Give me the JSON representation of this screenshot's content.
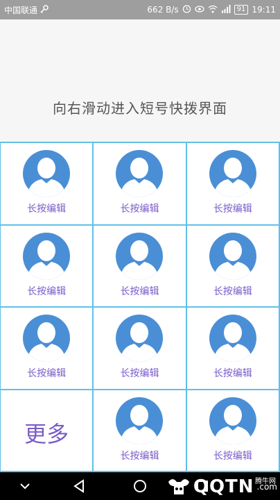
{
  "status_bar": {
    "carrier": "中国联通",
    "speed": "662 B/s",
    "battery": "91",
    "time": "19:11",
    "icons": [
      "key-icon",
      "alarm-icon",
      "eye-icon",
      "wifi-icon",
      "signal-icon",
      "battery-icon"
    ]
  },
  "banner": {
    "hint": "向右滑动进入短号快拨界面"
  },
  "grid": {
    "cells": [
      {
        "label": "长按编辑"
      },
      {
        "label": "长按编辑"
      },
      {
        "label": "长按编辑"
      },
      {
        "label": "长按编辑"
      },
      {
        "label": "长按编辑"
      },
      {
        "label": "长按编辑"
      },
      {
        "label": "长按编辑"
      },
      {
        "label": "长按编辑"
      },
      {
        "label": "长按编辑"
      },
      {
        "label": "长按编辑"
      },
      {
        "label": "长按编辑"
      }
    ],
    "more_label": "更多"
  },
  "nav_bar": {
    "buttons": [
      "back-icon",
      "home-icon",
      "recents-icon"
    ],
    "collapse": "chevron-down-icon"
  },
  "watermark": {
    "brand": "QQTN",
    "suffix": ".com",
    "tag": "腾牛网"
  },
  "colors": {
    "grid_border": "#5fc0e8",
    "avatar_blue": "#4a8fd6",
    "label_purple": "#7a5cc8"
  }
}
